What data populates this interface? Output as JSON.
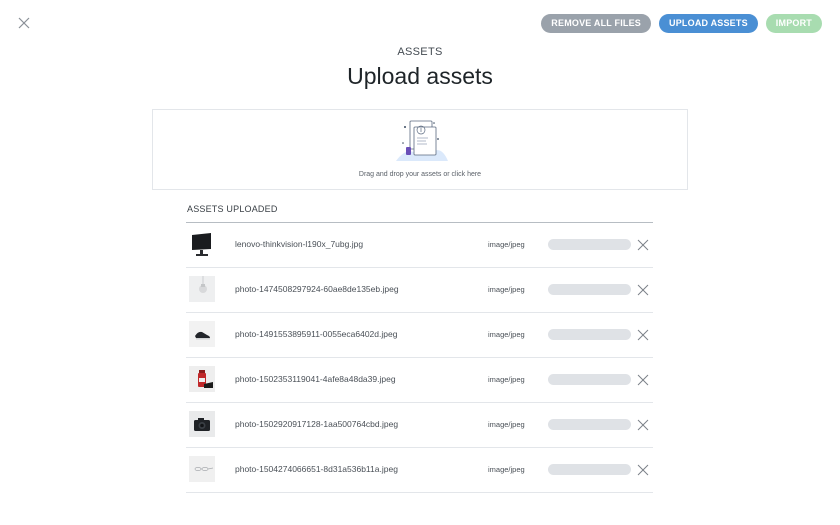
{
  "header": {
    "remove_all_label": "REMOVE ALL FILES",
    "upload_label": "UPLOAD ASSETS",
    "import_label": "IMPORT"
  },
  "eyebrow": "ASSETS",
  "title": "Upload assets",
  "dropzone": {
    "text": "Drag and drop your assets or click here"
  },
  "section_label": "ASSETS UPLOADED",
  "files": [
    {
      "name": "lenovo-thinkvision-l190x_7ubg.jpg",
      "type": "image/jpeg",
      "thumb": "monitor-icon",
      "progress": 0
    },
    {
      "name": "photo-1474508297924-60ae8de135eb.jpeg",
      "type": "image/jpeg",
      "thumb": "bulb-icon",
      "progress": 0
    },
    {
      "name": "photo-1491553895911-0055eca6402d.jpeg",
      "type": "image/jpeg",
      "thumb": "shoe-icon",
      "progress": 0
    },
    {
      "name": "photo-1502353119041-4afe8a48da39.jpeg",
      "type": "image/jpeg",
      "thumb": "bottle-icon",
      "progress": 0
    },
    {
      "name": "photo-1502920917128-1aa500764cbd.jpeg",
      "type": "image/jpeg",
      "thumb": "camera-icon",
      "progress": 0
    },
    {
      "name": "photo-1504274066651-8d31a536b11a.jpeg",
      "type": "image/jpeg",
      "thumb": "glasses-icon",
      "progress": 0
    }
  ],
  "colors": {
    "upload_accent": "#4a8fd4",
    "remove_gray": "#9aa2ab",
    "import_green": "#a8dcb0",
    "progress_track": "#dfe2e6"
  }
}
